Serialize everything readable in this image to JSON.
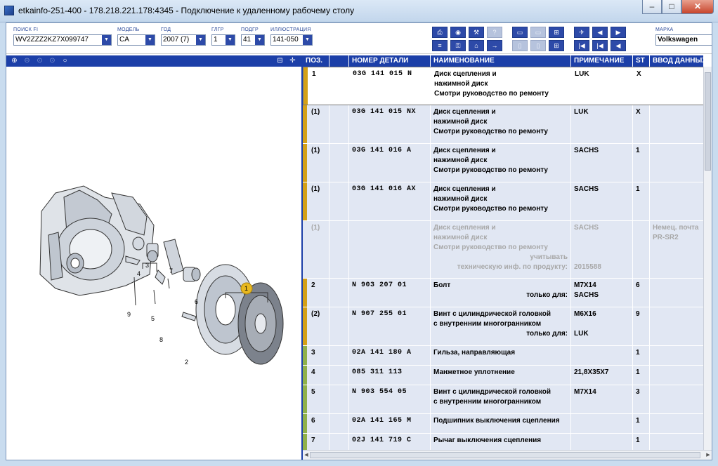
{
  "window": {
    "title": "etkainfo-251-400 - 178.218.221.178:4345 - Подключение к удаленному рабочему столу",
    "minimize": "–",
    "maximize": "□",
    "close": "✕"
  },
  "toolbar": {
    "vin": {
      "label": "ПОИСК FI",
      "value": "WV2ZZZ2KZ7X099747"
    },
    "model": {
      "label": "МОДЕЛЬ",
      "value": "CA"
    },
    "year": {
      "label": "ГОД",
      "value": "2007 (7)"
    },
    "mgroup": {
      "label": "ГЛГР",
      "value": "1"
    },
    "sgroup": {
      "label": "ПОДГР",
      "value": "41"
    },
    "illustration": {
      "label": "ИЛЛЮСТРАЦИЯ",
      "value": "141-050"
    },
    "brand": {
      "label": "МАРКА",
      "value": "Volkswagen"
    }
  },
  "diagram": {
    "callouts": [
      "1",
      "2",
      "3",
      "4",
      "5",
      "6",
      "7",
      "8",
      "9"
    ],
    "highlight_color": "#e8b820"
  },
  "table": {
    "headers": [
      "ПОЗ.",
      "",
      "НОМЕР ДЕТАЛИ",
      "НАИМЕНОВАНИЕ",
      "ПРИМЕЧАНИЕ",
      "ST",
      "ВВОД ДАННЫХ"
    ],
    "rows": [
      {
        "pos": "1",
        "part": "03G 141 015 N",
        "name": [
          "Диск сцепления и",
          "нажимной диск",
          "Смотри руководство по ремонту"
        ],
        "note": [
          "LUK"
        ],
        "st": "X",
        "data": [],
        "bar": "#d4a017",
        "selected": true
      },
      {
        "pos": "(1)",
        "part": "03G 141 015 NX",
        "name": [
          "Диск сцепления и",
          "нажимной диск",
          "Смотри руководство по ремонту"
        ],
        "note": [
          "LUK"
        ],
        "st": "X",
        "data": [],
        "bar": "#d4a017"
      },
      {
        "pos": "(1)",
        "part": "03G 141 016 A",
        "name": [
          "Диск сцепления и",
          "нажимной диск",
          "Смотри руководство по ремонту"
        ],
        "note": [
          "SACHS"
        ],
        "st": "1",
        "data": [],
        "bar": "#d4a017"
      },
      {
        "pos": "(1)",
        "part": "03G 141 016 AX",
        "name": [
          "Диск сцепления и",
          "нажимной диск",
          "Смотри руководство по ремонту"
        ],
        "note": [
          "SACHS"
        ],
        "st": "1",
        "data": [],
        "bar": "#d4a017"
      },
      {
        "pos": "(1)",
        "part": "",
        "name": [
          "Диск сцепления и",
          "нажимной диск",
          "Смотри руководство по ремонту",
          "учитывать",
          "техническую инф. по продукту:"
        ],
        "note": [
          "SACHS",
          "",
          "",
          "",
          "2015588"
        ],
        "st": "",
        "data": [
          "Немец. почта",
          "PR-SR2"
        ],
        "bar": "",
        "disabled": true
      },
      {
        "pos": "2",
        "part": "N 903 207 01",
        "name": [
          "Болт",
          "только для:"
        ],
        "note": [
          "M7X14",
          "SACHS"
        ],
        "st": "6",
        "data": [],
        "bar": "#d4a017"
      },
      {
        "pos": "(2)",
        "part": "N 907 255 01",
        "name": [
          "Винт с цилиндрической головкой",
          "с внутренним многогранником",
          "только для:"
        ],
        "note": [
          "M6X16",
          "",
          "LUK"
        ],
        "st": "9",
        "data": [],
        "bar": "#d4a017"
      },
      {
        "pos": "3",
        "part": "02A 141 180 A",
        "name": [
          "Гильза, направляющая"
        ],
        "note": [
          ""
        ],
        "st": "1",
        "data": [],
        "bar": "#8fb04a"
      },
      {
        "pos": "4",
        "part": "085 311 113",
        "name": [
          "Манжетное уплотнение"
        ],
        "note": [
          "21,8X35X7"
        ],
        "st": "1",
        "data": [],
        "bar": "#8fb04a"
      },
      {
        "pos": "5",
        "part": "N 903 554 05",
        "name": [
          "Винт с цилиндрической головкой",
          "с внутренним многогранником"
        ],
        "note": [
          "M7X14"
        ],
        "st": "3",
        "data": [],
        "bar": "#8fb04a"
      },
      {
        "pos": "6",
        "part": "02A 141 165 M",
        "name": [
          "Подшипник выключения сцепления"
        ],
        "note": [
          ""
        ],
        "st": "1",
        "data": [],
        "bar": "#8fb04a"
      },
      {
        "pos": "7",
        "part": "02J 141 719 C",
        "name": [
          "Рычаг выключения сцепления"
        ],
        "note": [
          ""
        ],
        "st": "1",
        "data": [],
        "bar": "#8fb04a"
      }
    ]
  }
}
